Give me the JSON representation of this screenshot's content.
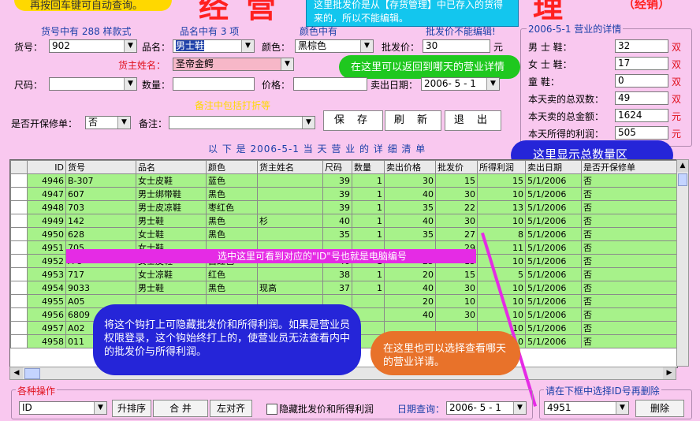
{
  "banner": {
    "title_left": "经",
    "title_mid": "营",
    "title_right": "理",
    "tag": "（经销）"
  },
  "top_tip_left": "再按回车键可自动查询。",
  "top_tip_center": "这里批发价是从【存货管理】中已存入的货得来的，所以不能编辑。",
  "form": {
    "count_label": "货号中有 288 样款式",
    "name_count_label": "品名中有 3 项",
    "color_count_label": "颜色中有",
    "hint_label": "批发价不能编辑!",
    "goods_no_label": "货号：",
    "goods_no_value": "902",
    "name_label": "品名：",
    "name_value": "男士鞋",
    "color_label": "颜色：",
    "color_value": "黑棕色",
    "wholesale_label": "批发价：",
    "wholesale_value": "30",
    "wholesale_unit": "元",
    "customer_label": "货主姓名：",
    "customer_value": "圣帝金鳄",
    "size_label": "尺码：",
    "size_value": "",
    "qty_label": "数量：",
    "qty_value": "",
    "price_label": "价格：",
    "price_value": "",
    "date_label": "卖出日期：",
    "date_value": "2006- 5 - 1",
    "repair_label": "是否开保修单：",
    "repair_value": "否",
    "remark_label": "备注：",
    "remark_value": "",
    "remark_hint": "备注中包括打折等",
    "save_label": "保 存",
    "refresh_label": "刷 新",
    "exit_label": "退 出"
  },
  "tip_back": "在这里可以返回到哪天的营业详情",
  "summary": {
    "title": "2006-5-1 营业的详情",
    "rows": [
      {
        "label": "男    士    鞋：",
        "value": "32",
        "unit": "双"
      },
      {
        "label": "女    士    鞋：",
        "value": "17",
        "unit": "双"
      },
      {
        "label": "童          鞋：",
        "value": "0",
        "unit": "双"
      },
      {
        "label": "本天卖的总双数：",
        "value": "49",
        "unit": "双"
      },
      {
        "label": "本天卖的总金额：",
        "value": "1624",
        "unit": "元"
      },
      {
        "label": "本天所得的利润：",
        "value": "505",
        "unit": "元"
      }
    ]
  },
  "tip_total": "这里显示总数量区",
  "list_title": "以 下 是 2006-5-1 当 天 营 业 的 详 细 清 单",
  "table": {
    "headers": [
      "",
      "ID",
      "货号",
      "品名",
      "颜色",
      "货主姓名",
      "尺码",
      "数量",
      "卖出价格",
      "批发价",
      "所得利润",
      "卖出日期",
      "是否开保修单"
    ],
    "rows": [
      {
        "id": "4946",
        "no": "B-307",
        "name": "女士皮鞋",
        "color": "蓝色",
        "owner": "",
        "size": "39",
        "qty": "1",
        "price": "30",
        "ws": "15",
        "profit": "15",
        "date": "5/1/2006",
        "repair": "否"
      },
      {
        "id": "4947",
        "no": "607",
        "name": "男士绑带鞋",
        "color": "黑色",
        "owner": "",
        "size": "39",
        "qty": "1",
        "price": "40",
        "ws": "30",
        "profit": "10",
        "date": "5/1/2006",
        "repair": "否"
      },
      {
        "id": "4948",
        "no": "703",
        "name": "男士皮凉鞋",
        "color": "枣红色",
        "owner": "",
        "size": "39",
        "qty": "1",
        "price": "35",
        "ws": "22",
        "profit": "13",
        "date": "5/1/2006",
        "repair": "否"
      },
      {
        "id": "4949",
        "no": "142",
        "name": "男士鞋",
        "color": "黑色",
        "owner": "杉",
        "size": "40",
        "qty": "1",
        "price": "40",
        "ws": "30",
        "profit": "10",
        "date": "5/1/2006",
        "repair": "否"
      },
      {
        "id": "4950",
        "no": "628",
        "name": "女士鞋",
        "color": "黑色",
        "owner": "",
        "size": "35",
        "qty": "1",
        "price": "35",
        "ws": "27",
        "profit": "8",
        "date": "5/1/2006",
        "repair": "否"
      },
      {
        "id": "4951",
        "no": "705",
        "name": "女士鞋",
        "color": "",
        "owner": "",
        "size": "",
        "qty": "",
        "price": "",
        "ws": "29",
        "profit": "11",
        "date": "5/1/2006",
        "repair": "否"
      },
      {
        "id": "4952",
        "no": "A-8",
        "name": "女士皮鞋",
        "color": "白红色",
        "owner": "",
        "size": "40",
        "qty": "1",
        "price": "25",
        "ws": "15",
        "profit": "10",
        "date": "5/1/2006",
        "repair": "否"
      },
      {
        "id": "4953",
        "no": "717",
        "name": "女士凉鞋",
        "color": "红色",
        "owner": "",
        "size": "38",
        "qty": "1",
        "price": "20",
        "ws": "15",
        "profit": "5",
        "date": "5/1/2006",
        "repair": "否"
      },
      {
        "id": "4954",
        "no": "9033",
        "name": "男士鞋",
        "color": "黑色",
        "owner": "现高",
        "size": "37",
        "qty": "1",
        "price": "40",
        "ws": "30",
        "profit": "10",
        "date": "5/1/2006",
        "repair": "否"
      },
      {
        "id": "4955",
        "no": "A05",
        "name": "",
        "color": "",
        "owner": "",
        "size": "",
        "qty": "",
        "price": "20",
        "ws": "10",
        "profit": "10",
        "date": "5/1/2006",
        "repair": "否"
      },
      {
        "id": "4956",
        "no": "6809",
        "name": "",
        "color": "",
        "owner": "",
        "size": "",
        "qty": "",
        "price": "40",
        "ws": "30",
        "profit": "10",
        "date": "5/1/2006",
        "repair": "否"
      },
      {
        "id": "4957",
        "no": "A02",
        "name": "",
        "color": "",
        "owner": "",
        "size": "",
        "qty": "",
        "price": "",
        "ws": "",
        "profit": "10",
        "date": "5/1/2006",
        "repair": "否"
      },
      {
        "id": "4958",
        "no": "011",
        "name": "",
        "color": "",
        "owner": "",
        "size": "",
        "qty": "",
        "price": "",
        "ws": "",
        "profit": "10",
        "date": "5/1/2006",
        "repair": "否"
      }
    ]
  },
  "tip_row": "选中这里可看到对应的\"ID\"号也就是电脑编号",
  "tip_hide": "将这个钩打上可隐藏批发价和所得利润。如果是营业员权限登录，这个钩始终打上的，使营业员无法查看内中的批发价与所得利润。",
  "tip_date": "在这里也可以选择查看哪天的营业详请。",
  "bottom": {
    "ops_title": "各种操作",
    "sort_value": "ID",
    "sort_btn": "升排序",
    "merge_btn": "合 并",
    "align_btn": "左对齐",
    "hide_label": "隐藏批发价和所得利润",
    "date_query_label": "日期查询：",
    "date_query_value": "2006- 5 - 1",
    "delete_title": "请在下框中选择ID号再删除",
    "delete_value": "4951",
    "delete_btn": "删除"
  },
  "colors": {
    "bg": "#f9c8ef",
    "grid": "#a7f28a",
    "blue_bubble": "#2525d8",
    "green_bubble": "#1fc81f",
    "orange_bubble": "#e8722a",
    "yellow_bubble": "#ffd800"
  }
}
